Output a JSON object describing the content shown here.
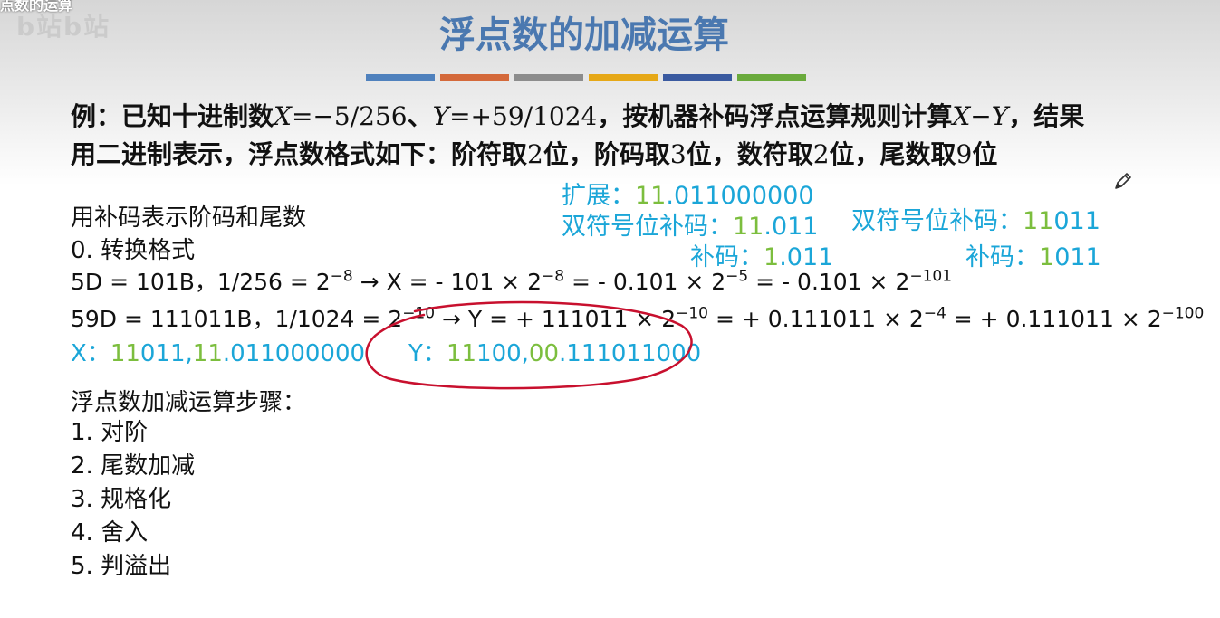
{
  "header": {
    "corner_title": "点数的运算",
    "corner_logo": "b站b站",
    "title": "浮点数的加减运算",
    "color_bar": [
      "#4f81bd",
      "#d4693a",
      "#8c8c8c",
      "#e6a817",
      "#3a5aa0",
      "#6aaa3c"
    ]
  },
  "problem": {
    "line1_a": "例：已知十进制数",
    "line1_x": "X",
    "line1_xval": "=−5/256",
    "line1_b": "、",
    "line1_y": "Y",
    "line1_yval": "=+59/1024",
    "line1_c": "，按机器补码浮点运算规则计算",
    "line1_expr": "X−Y",
    "line1_d": "，结果",
    "line2_a": "用二进制表示，浮点数格式如下：阶符取",
    "line2_n1": "2",
    "line2_b": "位，阶码取",
    "line2_n2": "3",
    "line2_c": "位，数符取",
    "line2_n3": "2",
    "line2_d": "位，尾数取",
    "line2_n4": "9",
    "line2_e": "位"
  },
  "annotations": {
    "extend_label": "扩展：",
    "extend_green": "11",
    "extend_blue": ".011000000",
    "dbl_label": "双符号位补码：",
    "dbl_green": "11",
    "dbl_blue": ".011",
    "comp_label": "补码：",
    "comp_green": "1",
    "comp_blue": ".011",
    "dbl2_label": "双符号位补码：",
    "dbl2_green": "11",
    "dbl2_blue": "011",
    "comp2_label": "补码：",
    "comp2_green": "1",
    "comp2_blue": "011"
  },
  "content": {
    "heading": "用补码表示阶码和尾数",
    "step0": "0.  转换格式",
    "eq1": {
      "a": "5D = 101B，1/256 = 2",
      "e1": "−8",
      "b": " → X = - 101 × 2",
      "e2": "−8",
      "c": " = - 0.101 × 2",
      "e3": "−5",
      "d": " = - 0.101 × 2",
      "e4": "−101"
    },
    "eq2": {
      "a": "59D = 111011B，1/1024 = 2",
      "e1": "−10",
      "b": " → Y = + 111011 × 2",
      "e2": "−10",
      "c": " = + 0.111011 × 2",
      "e3": "−4",
      "d": " = + 0.111011 × 2",
      "e4": "−100"
    },
    "xy": {
      "x_label": "X：",
      "x_g1": "11",
      "x_b1": "011,",
      "x_g2": "11",
      "x_b2": ".011000000",
      "y_label": "Y：",
      "y_g1": "11",
      "y_b1": "100,",
      "y_g2": "00",
      "y_b2": ".111011000"
    },
    "steps_heading": "浮点数加减运算步骤：",
    "steps": [
      "1.  对阶",
      "2.  尾数加减",
      "3.  规格化",
      "4.  舍入",
      "5.  判溢出"
    ]
  },
  "colors": {
    "title": "#4a78b0",
    "blue_text": "#1ba6d8",
    "green_text": "#7cbe3e",
    "annotation_circle": "#c8102e"
  }
}
